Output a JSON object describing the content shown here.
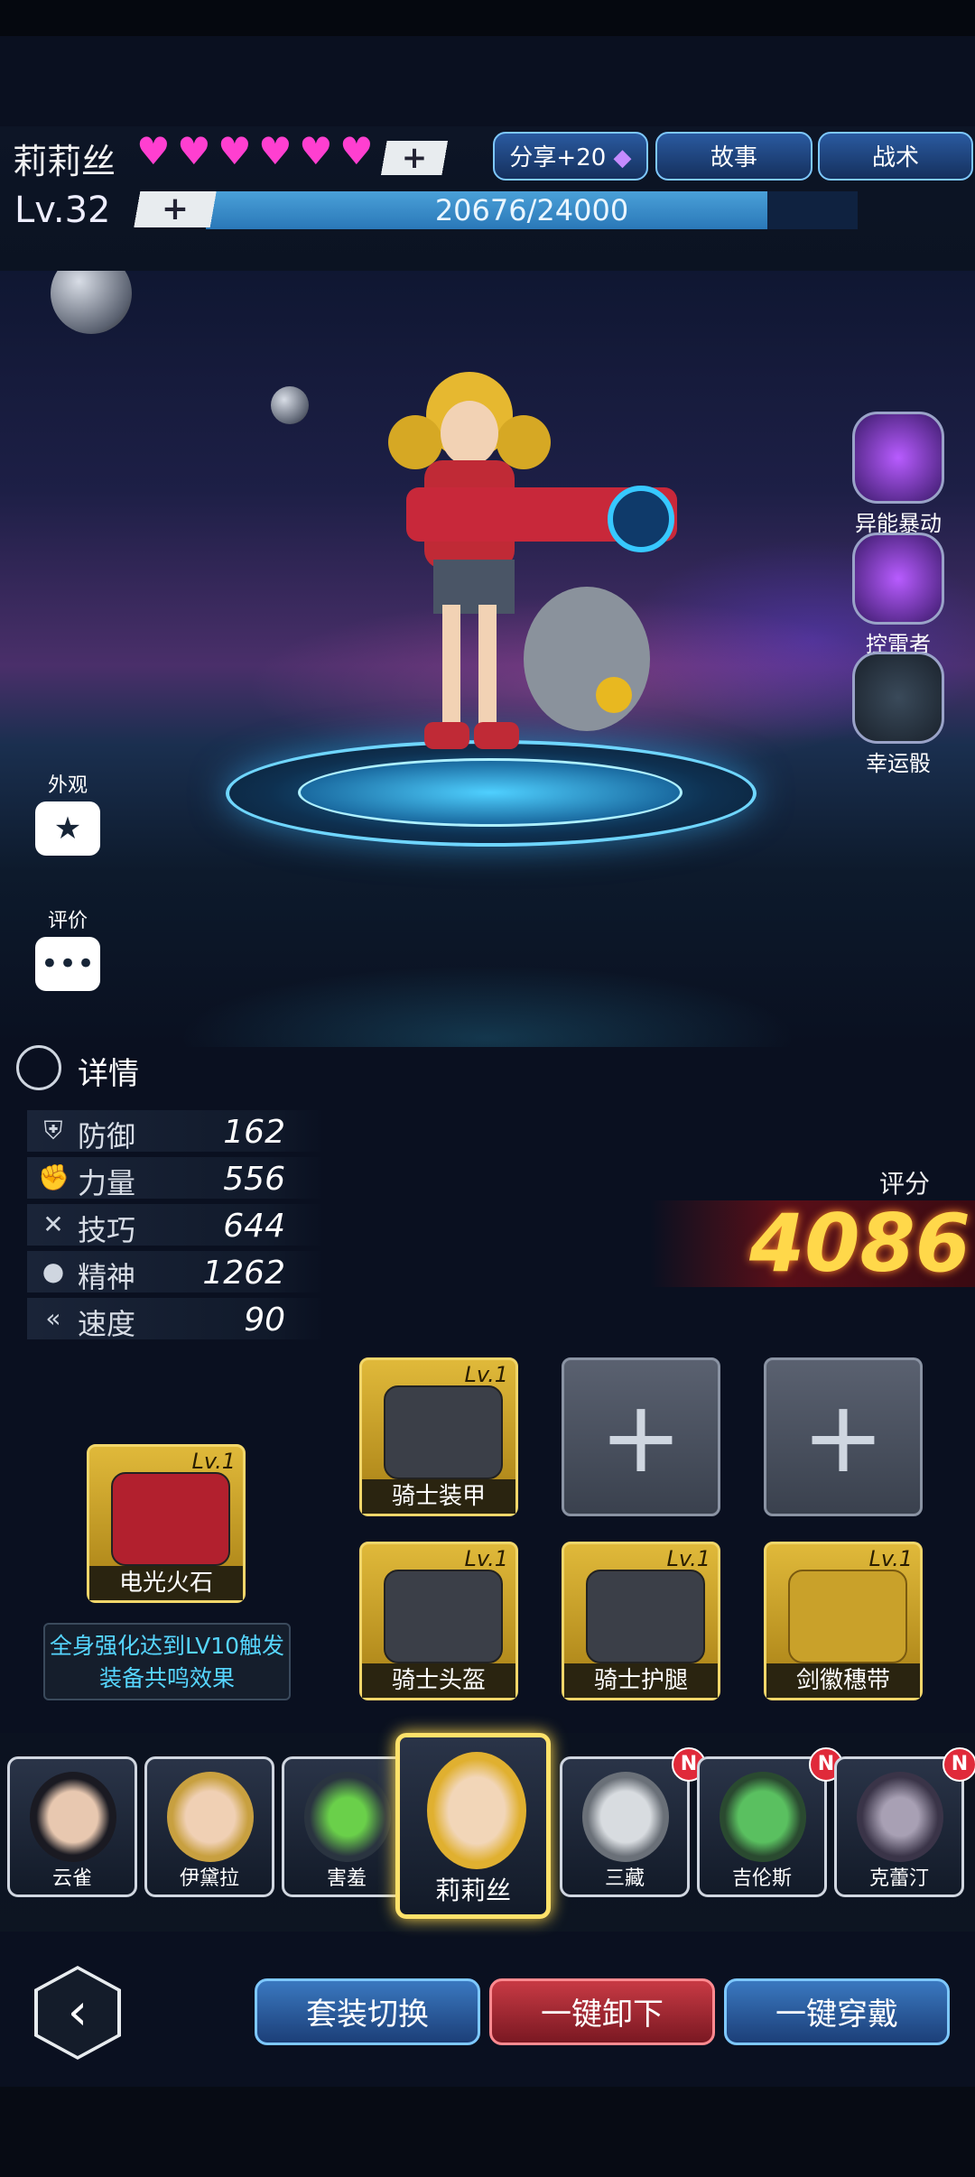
{
  "header": {
    "character_name": "莉莉丝",
    "hearts_count": 6,
    "heart_plus": "+",
    "share_button": "分享+20",
    "story_button": "故事",
    "tactics_button": "战术",
    "level": "Lv.32",
    "exp_plus": "+",
    "exp_text": "20676/24000",
    "exp_fraction": 0.8615
  },
  "side_skills": [
    {
      "label": "异能暴动",
      "icon": "psionic-burst-icon"
    },
    {
      "label": "控雷者",
      "icon": "thunder-controller-icon"
    },
    {
      "label": "幸运骰",
      "icon": "lucky-dice-icon"
    }
  ],
  "left_buttons": {
    "appearance": "外观",
    "review": "评价"
  },
  "details": {
    "title": "详情",
    "stats": [
      {
        "name": "防御",
        "value": "162",
        "icon": "shield-icon"
      },
      {
        "name": "力量",
        "value": "556",
        "icon": "fist-icon"
      },
      {
        "name": "技巧",
        "value": "644",
        "icon": "tools-icon"
      },
      {
        "name": "精神",
        "value": "1262",
        "icon": "brain-icon"
      },
      {
        "name": "速度",
        "value": "90",
        "icon": "speed-icon"
      }
    ],
    "score_label": "评分",
    "score_value": "4086"
  },
  "equipment": {
    "weapon": {
      "name": "电光火石",
      "level": "Lv.1"
    },
    "resonance_text_1": "全身强化达到LV10触发",
    "resonance_text_2": "装备共鸣效果",
    "armor": {
      "name": "骑士装甲",
      "level": "Lv.1"
    },
    "helmet": {
      "name": "骑士头盔",
      "level": "Lv.1"
    },
    "legs": {
      "name": "骑士护腿",
      "level": "Lv.1"
    },
    "badge": {
      "name": "剑徽穗带",
      "level": "Lv.1"
    },
    "empty_plus": "+"
  },
  "roster": [
    {
      "name": "云雀",
      "new": false
    },
    {
      "name": "伊黛拉",
      "new": false
    },
    {
      "name": "害羞",
      "new": false
    },
    {
      "name": "莉莉丝",
      "new": false,
      "selected": true
    },
    {
      "name": "三藏",
      "new": true
    },
    {
      "name": "吉伦斯",
      "new": true
    },
    {
      "name": "克蕾汀",
      "new": true
    }
  ],
  "new_badge": "N",
  "bottom": {
    "back": "‹",
    "switch_set": "套装切换",
    "unequip_all": "一键卸下",
    "equip_all": "一键穿戴"
  }
}
